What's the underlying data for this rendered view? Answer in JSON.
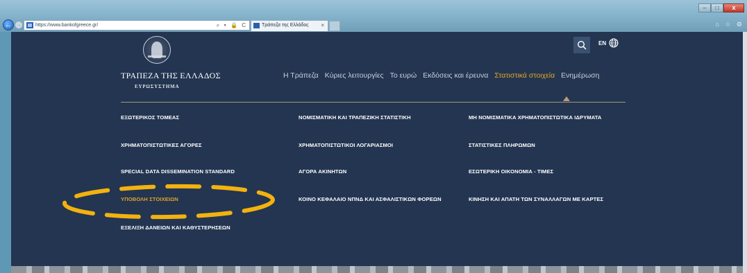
{
  "browser": {
    "url": "https://www.bankofgreece.gr/",
    "tab_title": "Τράπεζα της Ελλάδος",
    "tab_close": "×",
    "address_tools": "⌕ ▾ 🔒 C",
    "window_min": "–",
    "window_max": "□",
    "window_close": "x",
    "toolbar_icons": "⌂ ☆ ⚙"
  },
  "site": {
    "brand_name": "ΤΡΑΠΕΖΑ ΤΗΣ ΕΛΛΑΔΟΣ",
    "brand_sub": "ΕΥΡΩΣΥΣΤΗΜΑ",
    "lang": "EN"
  },
  "nav": {
    "items": [
      "Η Τράπεζα",
      "Κύριες λειτουργίες",
      "Το ευρώ",
      "Εκδόσεις και έρευνα",
      "Στατιστικά στοιχεία",
      "Ενημέρωση"
    ],
    "active_index": 4
  },
  "submenu": {
    "col1": [
      "ΕΞΩΤΕΡΙΚΟΣ ΤΟΜΕΑΣ",
      "ΧΡΗΜΑΤΟΠΙΣΤΩΤΙΚΕΣ ΑΓΟΡΕΣ",
      "SPECIAL DATA DISSEMINATION STANDARD",
      "ΥΠΟΒΟΛΗ ΣΤΟΙΧΕΙΩΝ",
      "ΕΞΕΛΙΞΗ ΔΑΝΕΙΩΝ ΚΑΙ ΚΑΘΥΣΤΕΡΗΣΕΩΝ"
    ],
    "col2": [
      "ΝΟΜΙΣΜΑΤΙΚΗ ΚΑΙ ΤΡΑΠΕΖΙΚΗ ΣΤΑΤΙΣΤΙΚΗ",
      "ΧΡΗΜΑΤΟΠΙΣΤΩΤΙΚΟΙ ΛΟΓΑΡΙΑΣΜΟΙ",
      "ΑΓΟΡΑ ΑΚΙΝΗΤΩΝ",
      "ΚΟΙΝΟ ΚΕΦΑΛΑΙΟ ΝΠΝΔ ΚΑΙ ΑΣΦΑΛΙΣΤΙΚΩΝ ΦΟΡΕΩΝ"
    ],
    "col3": [
      "ΜΗ ΝΟΜΙΣΜΑΤΙΚΑ ΧΡΗΜΑΤΟΠΙΣΤΩΤΙΚΑ ΙΔΡΥΜΑΤΑ",
      "ΣΤΑΤΙΣΤΙΚΕΣ ΠΛΗΡΩΜΩΝ",
      "ΕΣΩΤΕΡΙΚΗ ΟΙΚΟΝΟΜΙΑ - ΤΙΜΕΣ",
      "ΚΙΝΗΣΗ ΚΑΙ ΑΠΑΤΗ ΤΩΝ ΣΥΝΑΛΛΑΓΩΝ ΜΕ ΚΑΡΤΕΣ"
    ],
    "highlighted": "ΥΠΟΒΟΛΗ ΣΤΟΙΧΕΙΩΝ"
  },
  "colors": {
    "background": "#233551",
    "accent": "#e7a726",
    "annotation": "#f2b20f"
  }
}
